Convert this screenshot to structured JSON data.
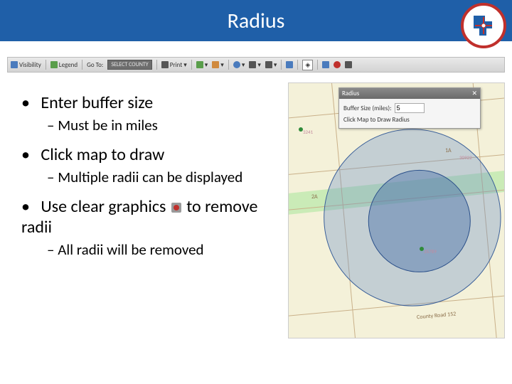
{
  "title": "Radius",
  "toolbar": {
    "visibility": "Visibility",
    "legend": "Legend",
    "goto": "Go To:",
    "select_county": "SELECT COUNTY",
    "print": "Print"
  },
  "bullets": {
    "b1": "Enter buffer size",
    "b1s": "Must be in miles",
    "b2": "Click map to draw",
    "b2s": "Multiple radii can be displayed",
    "b3a": "Use clear graphics",
    "b3b": "to remove radii",
    "b3s": "All radii will be removed"
  },
  "panel": {
    "title": "Radius",
    "label": "Buffer Size (miles):",
    "value": "5",
    "hint": "Click Map to Draw Radius"
  },
  "map": {
    "zone1": "1A",
    "zone2": "2A",
    "parcel1": "3241",
    "parcel2": "30922",
    "parcel3": "35789",
    "road": "County Road 152"
  }
}
